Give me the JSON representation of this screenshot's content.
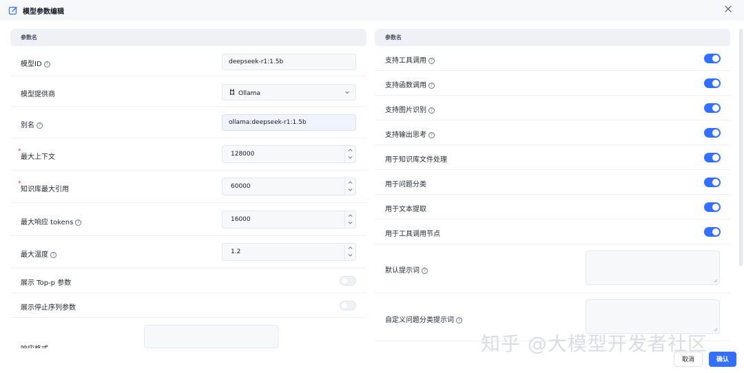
{
  "dialog": {
    "title": "模型参数编辑",
    "close_icon": "close-icon",
    "edit_icon": "edit-icon"
  },
  "left": {
    "header": "参数名",
    "model_id": {
      "label": "模型ID",
      "value": "deepseek-r1:1.5b"
    },
    "provider": {
      "label": "模型提供商",
      "value": "Ollama",
      "icon": "llama-icon"
    },
    "alias": {
      "label": "别名",
      "value": "ollama:deepseek-r1:1.5b"
    },
    "max_context": {
      "required": "*",
      "label": "最大上下文",
      "value": "128000"
    },
    "kb_max_quote": {
      "required": "*",
      "label": "知识库最大引用",
      "value": "60000"
    },
    "max_response": {
      "label": "最大响应 tokens",
      "value": "16000"
    },
    "max_temp": {
      "label": "最大温度",
      "value": "1.2"
    },
    "show_top_p": {
      "label": "展示 Top-p 参数",
      "enabled": false
    },
    "show_stop_seq": {
      "label": "展示停止序列参数",
      "enabled": false
    },
    "response_format": {
      "label": "响应格式"
    }
  },
  "right": {
    "header": "参数名",
    "toggles": [
      {
        "label": "支持工具调用",
        "help": true,
        "enabled": true
      },
      {
        "label": "支持函数调用",
        "help": true,
        "enabled": true
      },
      {
        "label": "支持图片识别",
        "help": true,
        "enabled": true
      },
      {
        "label": "支持输出思考",
        "help": true,
        "enabled": true
      },
      {
        "label": "用于知识库文件处理",
        "help": false,
        "enabled": true
      },
      {
        "label": "用于问题分类",
        "help": false,
        "enabled": true
      },
      {
        "label": "用于文本提取",
        "help": false,
        "enabled": true
      },
      {
        "label": "用于工具调用节点",
        "help": false,
        "enabled": true
      }
    ],
    "default_prompt": {
      "label": "默认提示词"
    },
    "custom_classify_prompt": {
      "label": "自定义问题分类提示词"
    }
  },
  "footer": {
    "cancel_label": "取消",
    "confirm_label": "确认"
  },
  "watermark": "知乎 @大模型开发者社区",
  "colors": {
    "accent": "#3370ff",
    "required": "#e8383d"
  }
}
